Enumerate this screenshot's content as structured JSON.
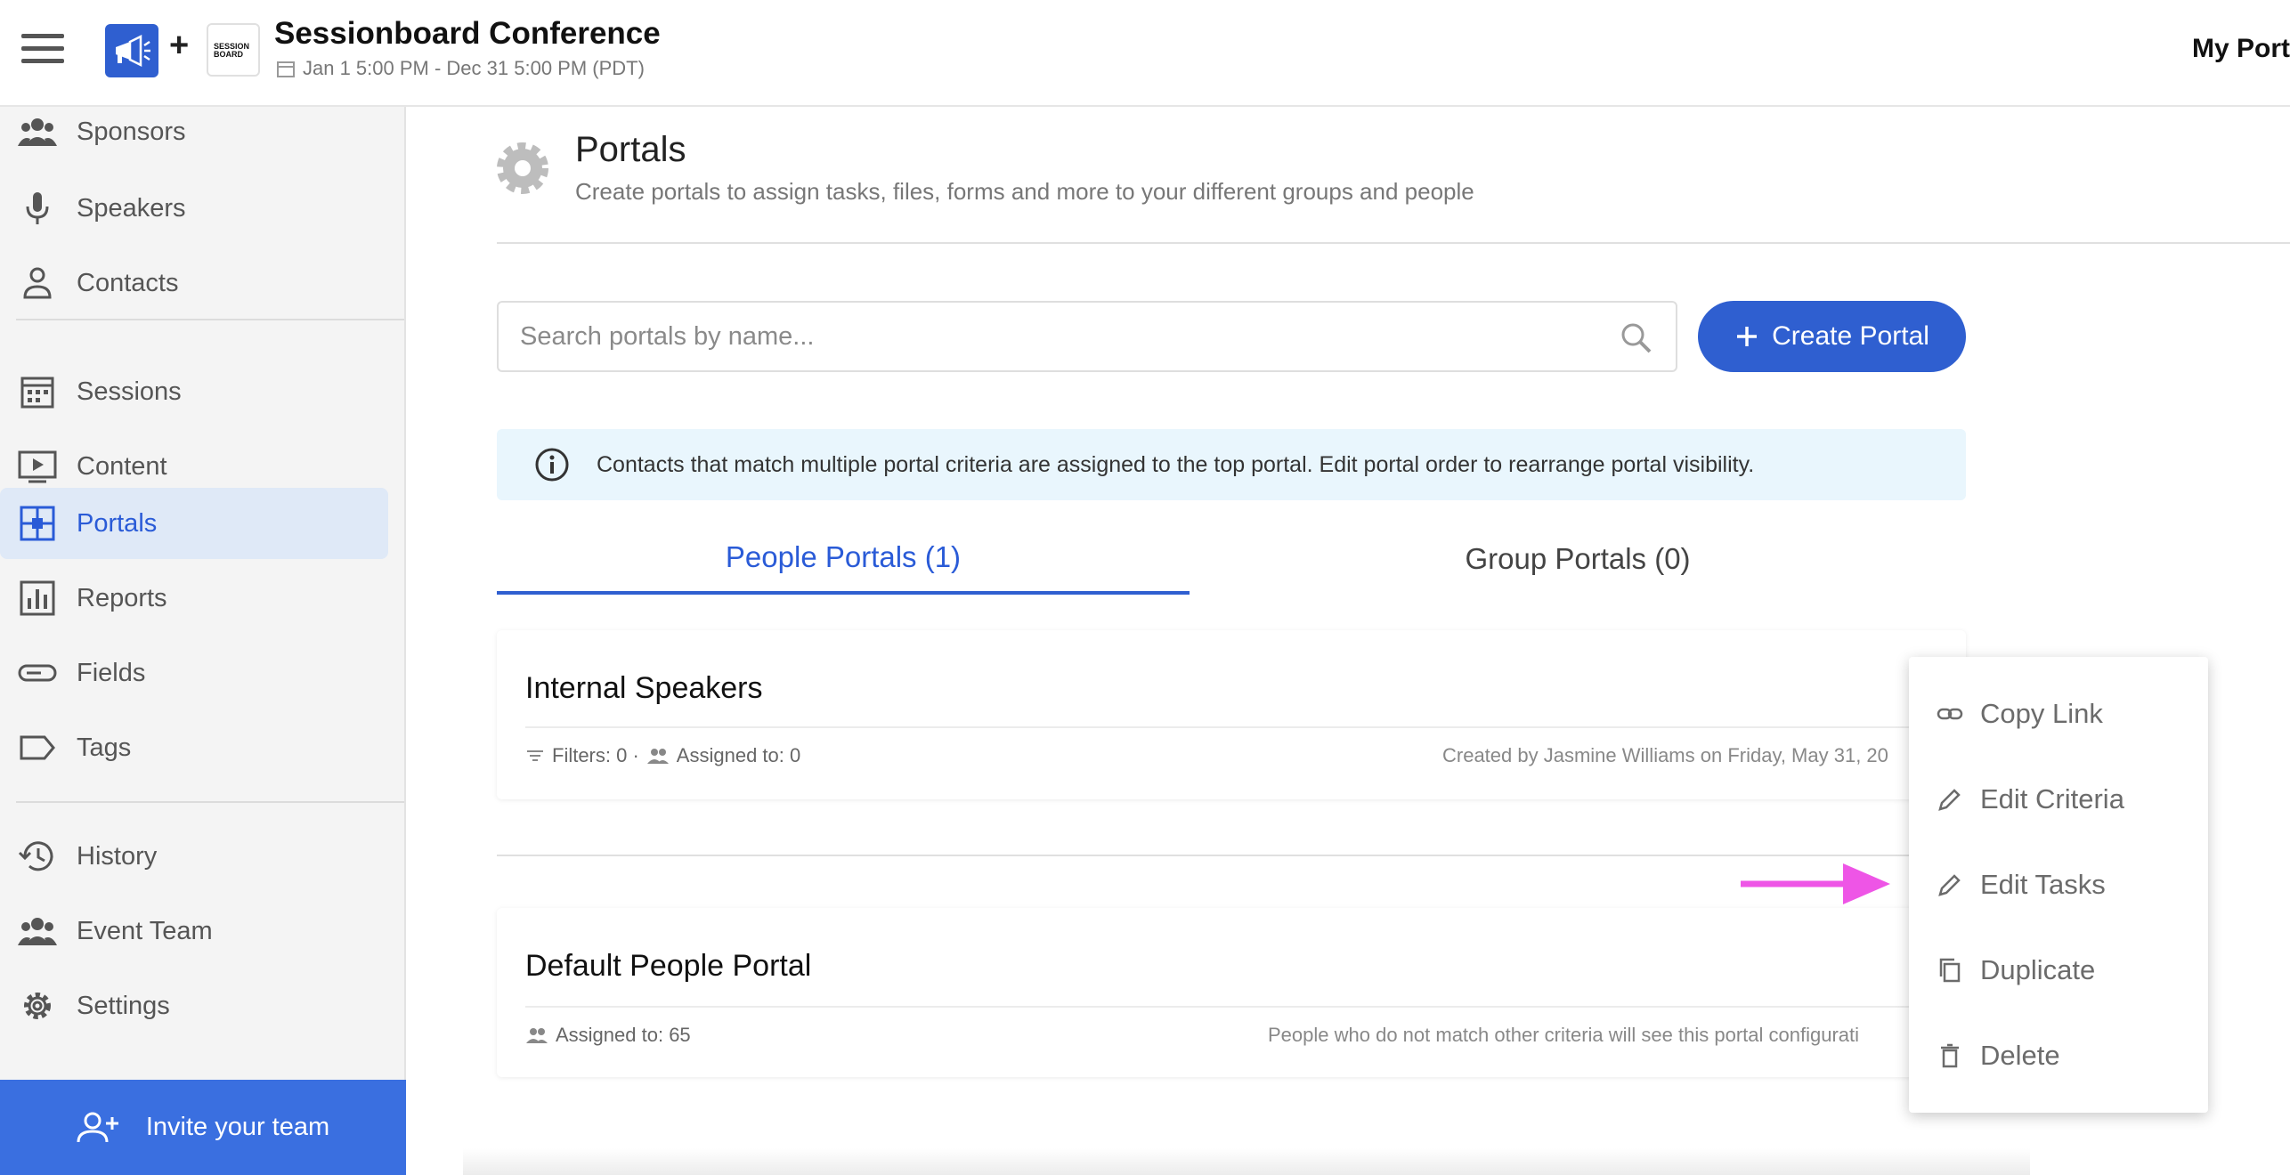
{
  "header": {
    "event_title": "Sessionboard Conference",
    "event_dates": "Jan 1 5:00 PM - Dec 31 5:00 PM (PDT)",
    "plus": "+",
    "logo_text_1": "SESSION",
    "logo_text_2": "BOARD",
    "right_link": "My Port"
  },
  "sidebar": {
    "items": [
      {
        "label": "Sponsors",
        "icon": "group-icon"
      },
      {
        "label": "Speakers",
        "icon": "microphone-icon"
      },
      {
        "label": "Contacts",
        "icon": "person-icon"
      },
      {
        "label": "Sessions",
        "icon": "calendar-icon"
      },
      {
        "label": "Content",
        "icon": "video-icon"
      },
      {
        "label": "Portals",
        "icon": "portal-icon"
      },
      {
        "label": "Reports",
        "icon": "bar-chart-icon"
      },
      {
        "label": "Fields",
        "icon": "field-icon"
      },
      {
        "label": "Tags",
        "icon": "tag-icon"
      },
      {
        "label": "History",
        "icon": "history-icon"
      },
      {
        "label": "Event Team",
        "icon": "group-icon"
      },
      {
        "label": "Settings",
        "icon": "gear-icon"
      }
    ],
    "active_item": "Portals",
    "invite_label": "Invite your team"
  },
  "main": {
    "page_title": "Portals",
    "page_subtitle": "Create portals to assign tasks, files, forms and more to your different groups and people",
    "search": {
      "placeholder": "Search portals by name...",
      "value": ""
    },
    "create_label": "Create Portal",
    "info_text": "Contacts that match multiple portal criteria are assigned to the top portal. Edit portal order to rearrange portal visibility.",
    "tabs": [
      {
        "label": "People Portals (1)",
        "active": true
      },
      {
        "label": "Group Portals (0)",
        "active": false
      }
    ],
    "portals": [
      {
        "name": "Internal Speakers",
        "filters": "Filters: 0 ·",
        "assigned": "Assigned to: 0",
        "right_text": "Created by Jasmine Williams on Friday, May 31, 20"
      }
    ],
    "default_portal": {
      "name": "Default People Portal",
      "assigned": "Assigned to: 65",
      "right_text": "People who do not match other criteria will see this portal configurati"
    }
  },
  "menu": {
    "items": [
      {
        "label": "Copy Link",
        "icon": "link-icon"
      },
      {
        "label": "Edit Criteria",
        "icon": "pencil-icon"
      },
      {
        "label": "Edit Tasks",
        "icon": "pencil-icon"
      },
      {
        "label": "Duplicate",
        "icon": "copy-icon"
      },
      {
        "label": "Delete",
        "icon": "trash-icon"
      }
    ]
  },
  "colors": {
    "primary": "#2f5fd0",
    "active_nav_bg": "#dfe9f7",
    "info_bg": "#e9f6fd",
    "invite_bg": "#3a6fe0",
    "annotation_arrow": "#ee55e6"
  }
}
